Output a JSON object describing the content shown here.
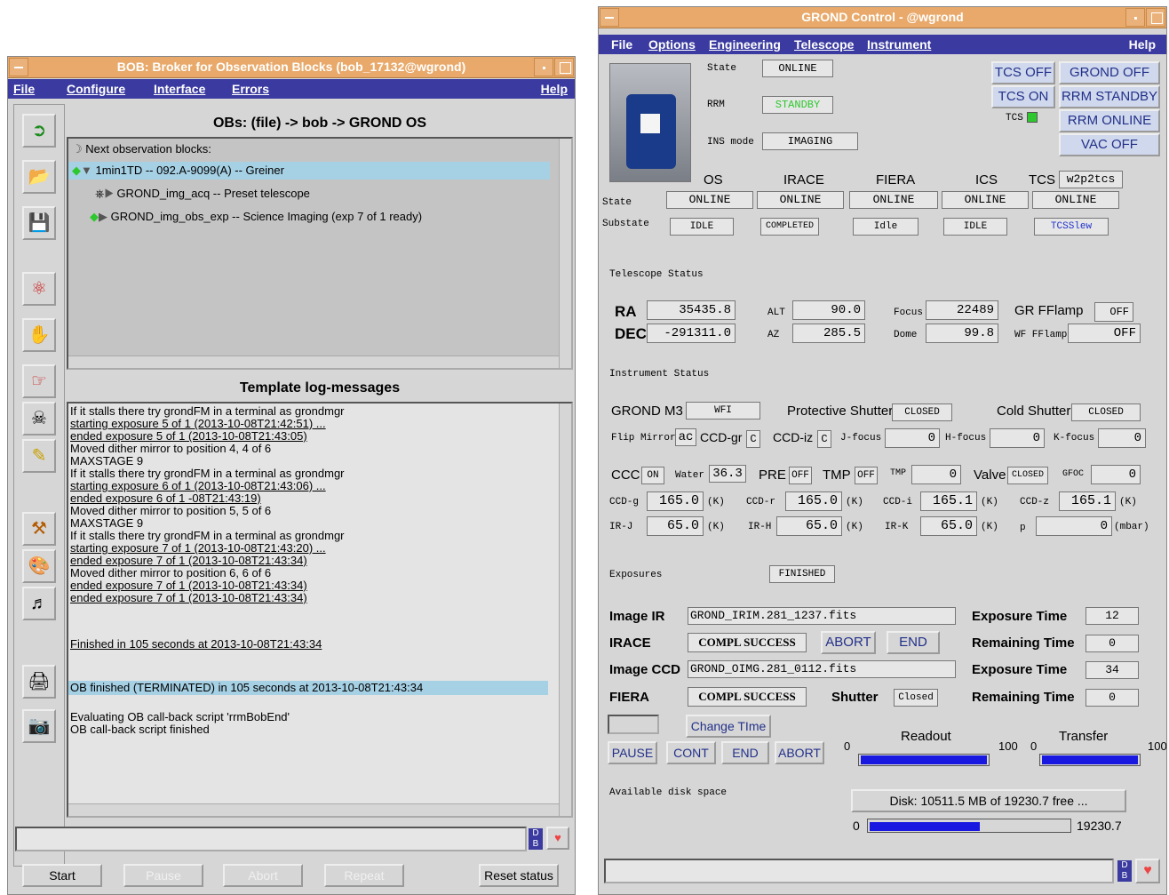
{
  "bob": {
    "title": "BOB: Broker for Observation Blocks (bob_17132@wgrond)",
    "menu": {
      "file": "File",
      "configure": "Configure",
      "interface": "Interface",
      "errors": "Errors",
      "help": "Help"
    },
    "obs_header": "OBs: (file) -> bob -> GROND OS",
    "tree": {
      "root": "Next observation blocks:",
      "ob": "1min1TD -- 092.A-9099(A) -- Greiner",
      "t1": "GROND_img_acq -- Preset telescope",
      "t2": "GROND_img_obs_exp -- Science Imaging (exp 7 of 1 ready)"
    },
    "log_header": "Template log-messages",
    "log": [
      "If it stalls there try grondFM in a terminal as grondmgr",
      "starting exposure 5 of 1 (2013-10-08T21:42:51) ...",
      "ended exposure 5 of 1 (2013-10-08T21:43:05)",
      "Moved dither mirror to position 4, 4 of 6",
      "MAXSTAGE 9",
      "If it stalls there try grondFM in a terminal as grondmgr",
      "starting exposure 6 of 1 (2013-10-08T21:43:06) ...",
      "ended exposure 6 of 1 -08T21:43:19)",
      "Moved dither mirror to position 5, 5 of 6",
      "MAXSTAGE 9",
      "If it stalls there try grondFM in a terminal as grondmgr",
      "starting exposure 7 of 1 (2013-10-08T21:43:20) ...",
      "ended exposure 7 of 1 (2013-10-08T21:43:34)",
      "Moved dither mirror to position 6, 6 of 6",
      "ended exposure 7 of 1 (2013-10-08T21:43:34)",
      "ended exposure 7 of 1 (2013-10-08T21:43:34)"
    ],
    "finished": "Finished in 105 seconds at 2013-10-08T21:43:34",
    "ob_finished": "OB finished (TERMINATED) in 105 seconds at 2013-10-08T21:43:34",
    "callback1": "Evaluating OB call-back script 'rrmBobEnd'",
    "callback2": "OB call-back script finished",
    "buttons": {
      "start": "Start",
      "pause": "Pause",
      "abort": "Abort",
      "repeat": "Repeat",
      "reset": "Reset status"
    }
  },
  "grond": {
    "title": "GROND Control - @wgrond",
    "menu": {
      "file": "File",
      "options": "Options",
      "engineering": "Engineering",
      "telescope": "Telescope",
      "instrument": "Instrument",
      "help": "Help"
    },
    "state_lbl": "State",
    "state": "ONLINE",
    "rrm_lbl": "RRM",
    "rrm": "STANDBY",
    "insmode_lbl": "INS mode",
    "insmode": "IMAGING",
    "buttons": {
      "tcs_off": "TCS OFF",
      "grond_off": "GROND OFF",
      "tcs_on": "TCS ON",
      "rrm_standby": "RRM STANDBY",
      "tcs_lbl": "TCS",
      "rrm_online": "RRM ONLINE",
      "vac_off": "VAC OFF"
    },
    "cols": {
      "os": "OS",
      "irace": "IRACE",
      "fiera": "FIERA",
      "ics": "ICS",
      "tcs": "TCS",
      "tcs_name": "w2p2tcs"
    },
    "row_state": "State",
    "row_substate": "Substate",
    "states": [
      "ONLINE",
      "ONLINE",
      "ONLINE",
      "ONLINE",
      "ONLINE"
    ],
    "substates": [
      "IDLE",
      "COMPLETED",
      "Idle",
      "IDLE",
      "TCSSlew"
    ],
    "tel_status": "Telescope Status",
    "ra_lbl": "RA",
    "ra": "35435.8",
    "dec_lbl": "DEC",
    "dec": "-291311.0",
    "alt_lbl": "ALT",
    "alt": "90.0",
    "az_lbl": "AZ",
    "az": "285.5",
    "focus_lbl": "Focus",
    "focus": "22489",
    "dome_lbl": "Dome",
    "dome": "99.8",
    "grff_lbl": "GR FFlamp",
    "grff": "OFF",
    "wfff_lbl": "WF FFlamp",
    "wfff": "OFF",
    "ins_status": "Instrument Status",
    "m3_lbl": "GROND M3",
    "m3": "WFI",
    "pshutter_lbl": "Protective Shutter",
    "pshutter": "CLOSED",
    "cshutter_lbl": "Cold Shutter",
    "cshutter": "CLOSED",
    "flip_lbl": "Flip Mirror",
    "flip": "ac",
    "ccdgr_lbl": "CCD-gr",
    "ccdgr": "C",
    "ccdiz_lbl": "CCD-iz",
    "ccdiz": "C",
    "jf_lbl": "J-focus",
    "jf": "0",
    "hf_lbl": "H-focus",
    "hf": "0",
    "kf_lbl": "K-focus",
    "kf": "0",
    "ccc_lbl": "CCC",
    "ccc": "ON",
    "water_lbl": "Water",
    "water": "36.3",
    "pre_lbl": "PRE",
    "pre": "OFF",
    "tmp_lbl": "TMP",
    "tmp": "OFF",
    "tmp2_lbl": "TMP",
    "tmp2": "0",
    "valve_lbl": "Valve",
    "valve": "CLOSED",
    "gfoc_lbl": "GFOC",
    "gfoc": "0",
    "ccdg_lbl": "CCD-g",
    "ccdg": "165.0",
    "ccdr_lbl": "CCD-r",
    "ccdr": "165.0",
    "ccdi_lbl": "CCD-i",
    "ccdi": "165.1",
    "ccdz_lbl": "CCD-z",
    "ccdz": "165.1",
    "irj_lbl": "IR-J",
    "irj": "65.0",
    "irh_lbl": "IR-H",
    "irh": "65.0",
    "irk_lbl": "IR-K",
    "irk": "65.0",
    "p_lbl": "p",
    "p": "0",
    "unit_k": "(K)",
    "unit_mbar": "(mbar)",
    "exposures_lbl": "Exposures",
    "exposures": "FINISHED",
    "img_ir_lbl": "Image IR",
    "img_ir": "GROND_IRIM.281_1237.fits",
    "exptime_lbl": "Exposure Time",
    "exptime_ir": "12",
    "irace_lbl": "IRACE",
    "irace_status": "COMPL SUCCESS",
    "abort": "ABORT",
    "end": "END",
    "remtime_lbl": "Remaining Time",
    "remtime_ir": "0",
    "img_ccd_lbl": "Image CCD",
    "img_ccd": "GROND_OIMG.281_0112.fits",
    "exptime_ccd": "34",
    "fiera_lbl": "FIERA",
    "fiera_status": "COMPL SUCCESS",
    "shutter_lbl": "Shutter",
    "shutter": "Closed",
    "remtime_ccd": "0",
    "change_time": "Change TIme",
    "pause": "PAUSE",
    "cont": "CONT",
    "end2": "END",
    "abort2": "ABORT",
    "readout_lbl": "Readout",
    "transfer_lbl": "Transfer",
    "readout_min": "0",
    "readout_max": "100",
    "transfer_min": "0",
    "transfer_max": "100",
    "readout_progress": 1.0,
    "transfer_progress": 1.0,
    "disk_lbl": "Available disk space",
    "disk": "Disk: 10511.5 MB of 19230.7 free ...",
    "disk_min": "0",
    "disk_max": "19230.7",
    "disk_free_mb": 10511.5,
    "disk_total_mb": 19230.7
  },
  "colors": {
    "title_bar": "#e8a96a",
    "menu_bar": "#3a3aa0",
    "highlight": "#a6d0e4",
    "tree_node": "#2ec82e",
    "bar": "#1818e0",
    "button_text": "#22308a"
  }
}
